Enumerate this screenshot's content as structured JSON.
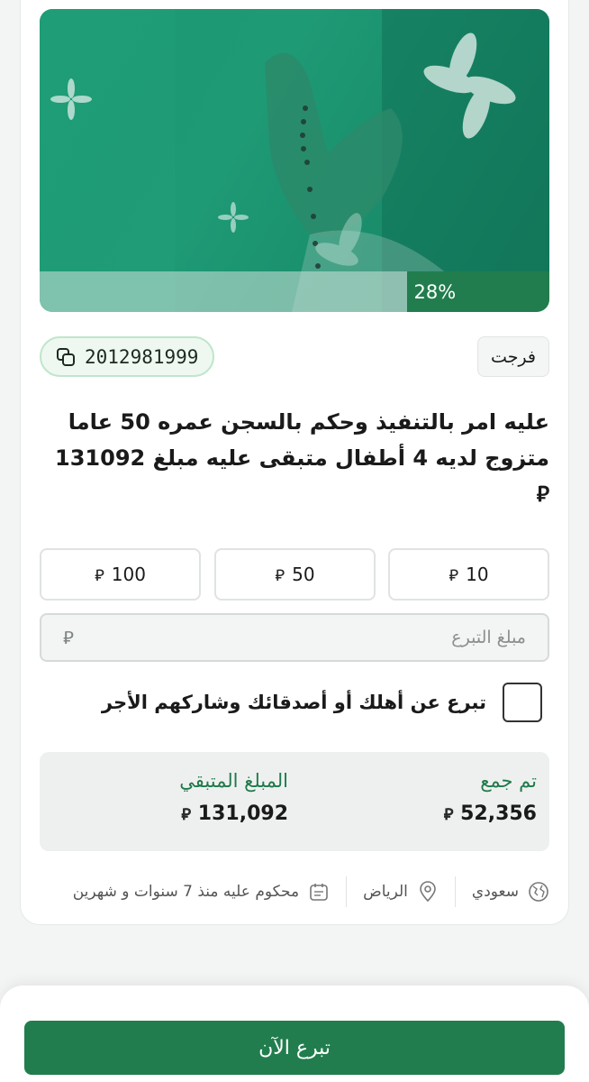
{
  "campaign": {
    "progress_percent": 28,
    "progress_label": "28%",
    "tag": "فرجت",
    "reference_id": "2012981999",
    "title": "عليه امر بالتنفيذ وحكم بالسجن عمره 50 عاما متزوج لديه 4 أطفال متبقى عليه مبلغ 131092 ⃁"
  },
  "donation": {
    "quick_amounts": [
      "10",
      "50",
      "100"
    ],
    "currency_symbol": "⃁",
    "amount_placeholder": "مبلغ التبرع",
    "gift_label": "تبرع عن أهلك أو أصدقائك وشاركهم الأجر",
    "gift_checked": false
  },
  "stats": {
    "collected_label": "تم جمع",
    "collected_value": "52,356",
    "remaining_label": "المبلغ المتبقي",
    "remaining_value": "131,092"
  },
  "meta": {
    "nationality": "سعودي",
    "city": "الرياض",
    "sentence": "محكوم عليه منذ 7 سنوات و شهرين"
  },
  "footer": {
    "donate_now": "تبرع الآن"
  },
  "colors": {
    "primary": "#217d4d",
    "hero_green": "#1b9b73"
  }
}
